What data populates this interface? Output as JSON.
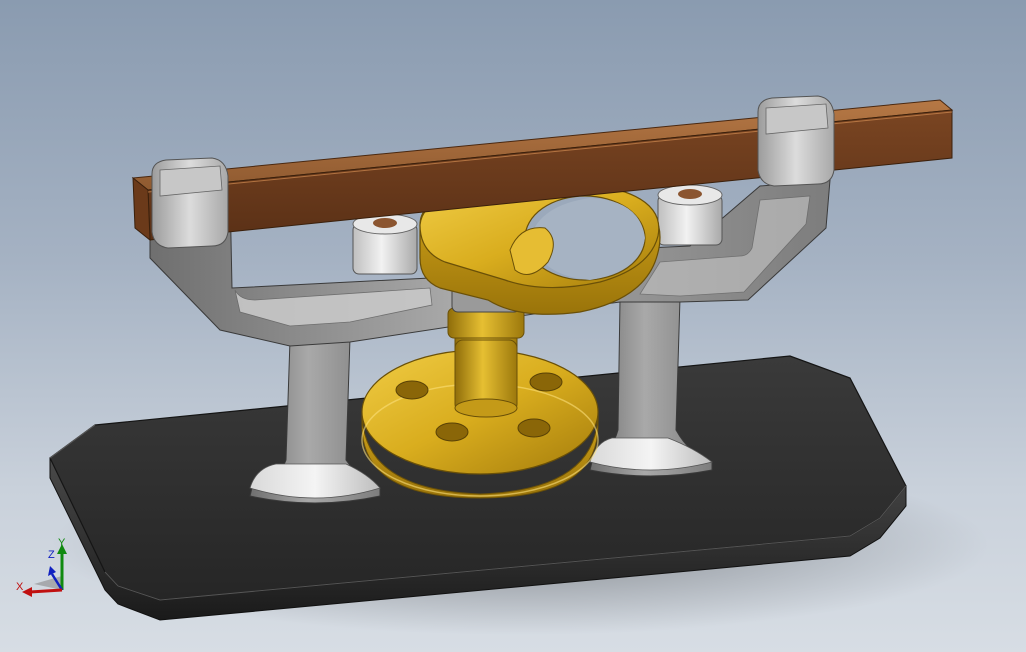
{
  "viewport": {
    "background_top": "#8a9bb0",
    "background_bottom": "#d7dde4"
  },
  "model": {
    "parts": [
      {
        "name": "base-plate",
        "color": "#2b2b2b"
      },
      {
        "name": "frame",
        "color": "#9a9a9a"
      },
      {
        "name": "rail-bar",
        "color": "#8b5530"
      },
      {
        "name": "rail-caps",
        "color": "#b9b9b9"
      },
      {
        "name": "rollers",
        "color": "#d8d8d8"
      },
      {
        "name": "yoke-ring",
        "color": "#d9ad1e"
      },
      {
        "name": "flange-disc",
        "color": "#d2a51b"
      },
      {
        "name": "shaft",
        "color": "#c9a020"
      }
    ]
  },
  "triad": {
    "x_label": "X",
    "y_label": "Y",
    "z_label": "Z",
    "x_color": "#c01010",
    "y_color": "#108a10",
    "z_color": "#1020c0"
  }
}
